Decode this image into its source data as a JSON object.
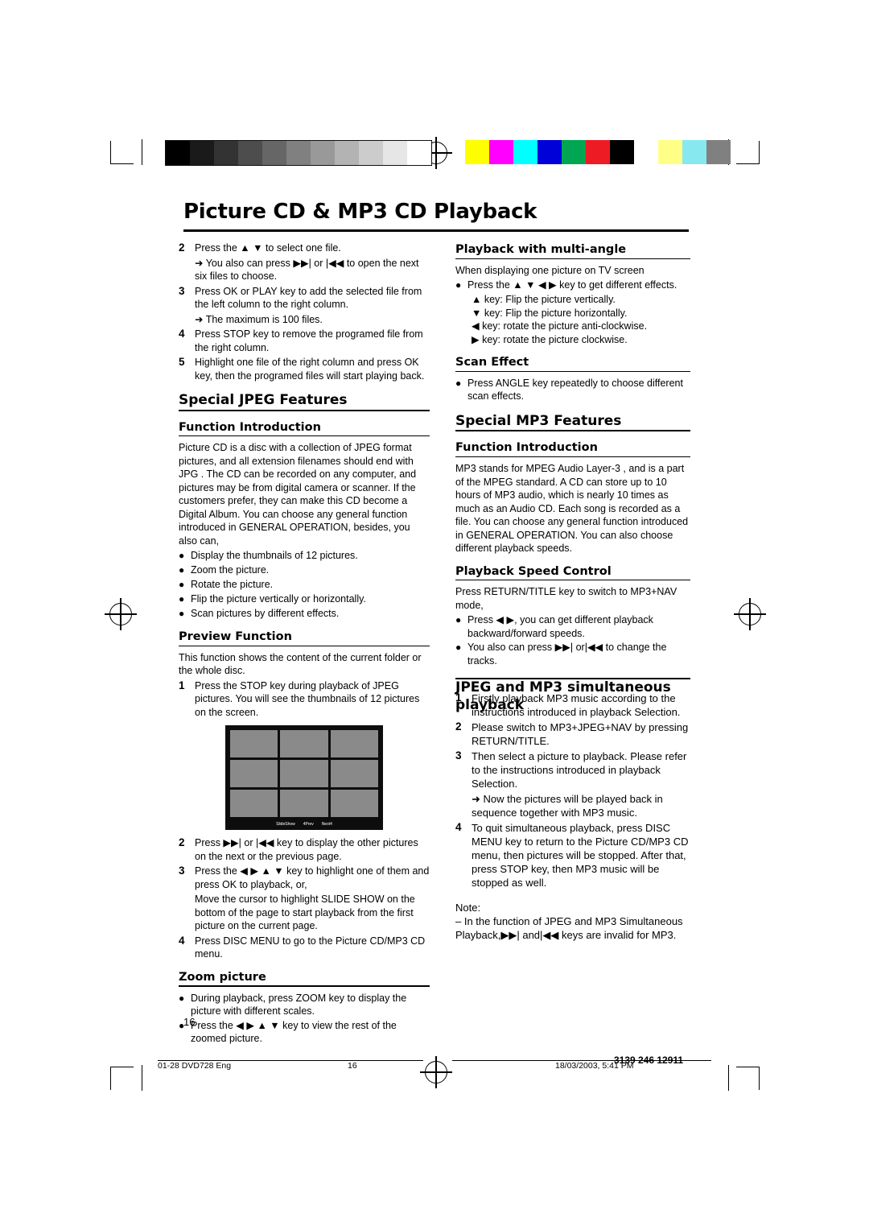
{
  "document": {
    "title": "Picture CD & MP3 CD Playback",
    "page_number": "16",
    "footer": {
      "file": "01-28 DVD728 Eng",
      "page": "16",
      "datetime": "18/03/2003, 5:41 PM",
      "code": "3139 246 12911"
    }
  },
  "left_column": {
    "steps_top": [
      {
        "n": "2",
        "text": "Press the ▲ ▼ to select one file."
      },
      {
        "n": "",
        "text": "➜ You also can press ▶▶| or |◀◀ to open the next six files to choose."
      },
      {
        "n": "3",
        "text": "Press OK or PLAY key to add the selected file from the left column to the right column."
      },
      {
        "n": "",
        "text": "➜ The maximum is 100 files."
      },
      {
        "n": "4",
        "text": "Press STOP key to remove the programed file from the right column."
      },
      {
        "n": "5",
        "text": "Highlight one file of the right column and press OK key, then the programed files will start playing back."
      }
    ],
    "special_jpeg_heading": "Special JPEG Features",
    "function_intro_heading": "Function Introduction",
    "function_intro_body": "Picture CD is a disc with a collection of JPEG format pictures, and all extension filenames should end with  JPG . The CD can be recorded on any computer, and pictures may be from digital camera or scanner. If the customers prefer, they can make this CD become a Digital Album. You can choose any general function introduced in GENERAL OPERATION, besides, you also can,",
    "feature_bullets": [
      "Display the thumbnails of 12 pictures.",
      "Zoom the picture.",
      "Rotate the picture.",
      "Flip the picture vertically or horizontally.",
      "Scan pictures by different effects."
    ],
    "preview_heading": "Preview Function",
    "preview_body": "This function shows the content of the current folder or the whole disc.",
    "preview_steps": [
      {
        "n": "1",
        "text": "Press the STOP key during playback of JPEG pictures. You will see the thumbnails of 12 pictures on the screen."
      }
    ],
    "thumbnail_screen": {
      "label_slideshow": "SlideShow",
      "label_prev": "4Prev",
      "label_next": "Next4"
    },
    "preview_steps2": [
      {
        "n": "2",
        "text": "Press ▶▶| or |◀◀ key to display the other pictures on the next or the previous page."
      },
      {
        "n": "3",
        "text": "Press the ◀ ▶ ▲ ▼ key to highlight one of them and press OK to playback, or,"
      },
      {
        "n": "",
        "text": "Move the cursor  to highlight SLIDE SHOW on the bottom of the page to start playback from the first picture on the current page."
      },
      {
        "n": "4",
        "text": "Press DISC MENU to go to the Picture CD/MP3 CD menu."
      }
    ],
    "zoom_heading": "Zoom picture",
    "zoom_bullets": [
      "During playback, press ZOOM key to display the picture with different scales.",
      "Press the ◀ ▶ ▲ ▼ key to view the rest of  the zoomed picture."
    ]
  },
  "right_column": {
    "multiangle_heading": "Playback with multi-angle",
    "multiangle_intro": "When displaying one picture on TV screen",
    "multiangle_bullet": "Press the ▲ ▼ ◀ ▶ key to get different effects.",
    "multiangle_keys": [
      "▲ key: Flip the picture vertically.",
      "▼ key: Flip the picture horizontally.",
      "◀ key: rotate the picture anti-clockwise.",
      "▶ key: rotate the picture clockwise."
    ],
    "scan_heading": "Scan Effect",
    "scan_bullet": "Press ANGLE key repeatedly to choose different scan effects.",
    "special_mp3_heading": "Special MP3 Features",
    "mp3_function_heading": "Function Introduction",
    "mp3_function_body": " MP3  stands for  MPEG Audio Layer-3 , and is a part of the MPEG standard. A CD can store up to 10 hours of MP3 audio, which is nearly 10 times as much as an Audio CD. Each song is recorded as a file. You can choose any general function introduced in GENERAL OPERATION. You can also choose different playback speeds.",
    "speed_heading": "Playback Speed Control",
    "speed_intro": "Press RETURN/TITLE key to switch to MP3+NAV mode,",
    "speed_bullets": [
      "Press ◀ ▶, you can get different playback backward/forward speeds.",
      "You also can press ▶▶| or|◀◀ to change the tracks."
    ],
    "simul_heading_line1": "JPEG and MP3 simultaneous",
    "simul_heading_line2": "playback",
    "simul_steps": [
      {
        "n": "1",
        "text": "Firstly playback MP3 music according to the instructions introduced in playback Selection."
      },
      {
        "n": "2",
        "text": "Please switch to MP3+JPEG+NAV by pressing RETURN/TITLE."
      },
      {
        "n": "3",
        "text": "Then select a picture to playback. Please refer to the instructions introduced in playback Selection."
      },
      {
        "n": "",
        "text": "➜  Now the pictures will be played back in sequence together with MP3 music."
      },
      {
        "n": "4",
        "text": "To quit simultaneous playback, press DISC MENU key to return to the Picture CD/MP3 CD menu, then pictures will be stopped. After that, press STOP key, then MP3 music will be stopped as well."
      }
    ],
    "note_label": "Note:",
    "note_text": "–   In the function of JPEG and MP3 Simultaneous Playback,▶▶| and|◀◀ keys are invalid for MP3."
  },
  "colors": {
    "gray_bars": [
      "#000000",
      "#1a1a1a",
      "#333333",
      "#4d4d4d",
      "#666666",
      "#808080",
      "#999999",
      "#b3b3b3",
      "#cccccc",
      "#e6e6e6",
      "#ffffff"
    ],
    "color_bars": [
      "#ffff00",
      "#ff00ff",
      "#00ffff",
      "#0000d8",
      "#00a651",
      "#ed1c24",
      "#000000",
      "#ffffff",
      "#ffff88",
      "#88e8f0",
      "#808080"
    ]
  }
}
